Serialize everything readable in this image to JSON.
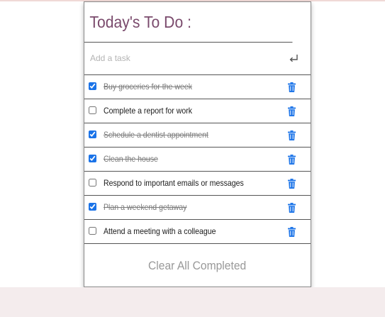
{
  "header": {
    "title": "Today's To Do :"
  },
  "add_task": {
    "placeholder": "Add a task",
    "value": "",
    "enter_icon": "enter-return-icon"
  },
  "tasks": [
    {
      "label": "Buy groceries for the week",
      "completed": true
    },
    {
      "label": "Complete a report for work",
      "completed": false
    },
    {
      "label": "Schedule a dentist appointment",
      "completed": true
    },
    {
      "label": "Clean the house",
      "completed": true
    },
    {
      "label": "Respond to important emails or messages",
      "completed": false
    },
    {
      "label": "Plan a weekend getaway",
      "completed": true
    },
    {
      "label": "Attend a meeting with a colleague",
      "completed": false
    }
  ],
  "task_icon": "trash-icon",
  "footer": {
    "clear_label": "Clear All Completed"
  },
  "colors": {
    "title": "#7a4a6c",
    "accent_blue": "#1a73e8",
    "completed_text": "#7a7a7a",
    "clear_text": "#999999",
    "page_bottom_band": "#f4eced"
  }
}
